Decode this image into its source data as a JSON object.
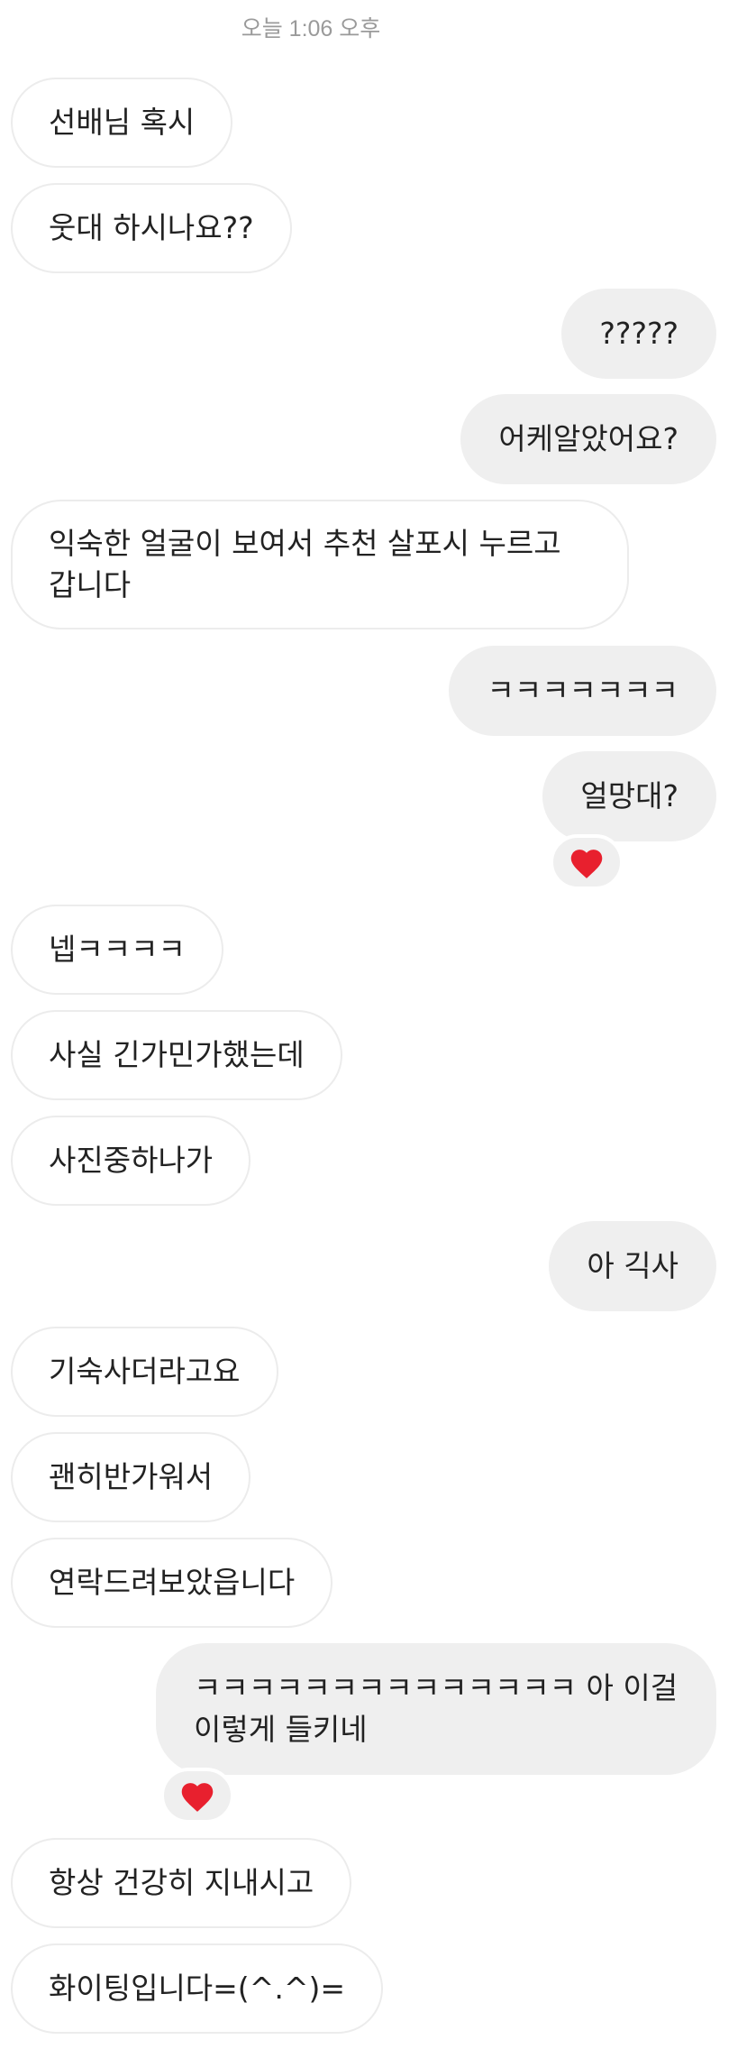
{
  "timestamp": "오늘 1:06 오후",
  "messages": [
    {
      "side": "in",
      "text": "선배님 혹시"
    },
    {
      "side": "in",
      "text": "웃대 하시나요??"
    },
    {
      "side": "out",
      "text": "?????"
    },
    {
      "side": "out",
      "text": "어케알았어요?"
    },
    {
      "side": "in",
      "text": "익숙한 얼굴이 보여서 추천 살포시 누르고 갑니다"
    },
    {
      "side": "out",
      "text": "ㅋㅋㅋㅋㅋㅋㅋ"
    },
    {
      "side": "out",
      "text": "얼망대?",
      "reaction": "heart-icon"
    },
    {
      "side": "in",
      "text": "넵ㅋㅋㅋㅋ"
    },
    {
      "side": "in",
      "text": "사실 긴가민가했는데"
    },
    {
      "side": "in",
      "text": "사진중하나가"
    },
    {
      "side": "out",
      "text": "아 긱사"
    },
    {
      "side": "in",
      "text": "기숙사더라고요"
    },
    {
      "side": "in",
      "text": "괜히반가워서"
    },
    {
      "side": "in",
      "text": "연락드려보았읍니다"
    },
    {
      "side": "out",
      "text": "ㅋㅋㅋㅋㅋㅋㅋㅋㅋㅋㅋㅋㅋㅋ 아 이걸 이렇게 들키네",
      "reaction": "heart-icon"
    },
    {
      "side": "in",
      "text": "항상 건강히 지내시고"
    },
    {
      "side": "in",
      "text": "화이팅입니다=(^.^)="
    }
  ],
  "colors": {
    "incoming_bubble": "#ffffff",
    "incoming_border": "#ececec",
    "outgoing_bubble": "#efefef",
    "heart": "#e8202e",
    "timestamp_text": "#9a9a9a"
  }
}
